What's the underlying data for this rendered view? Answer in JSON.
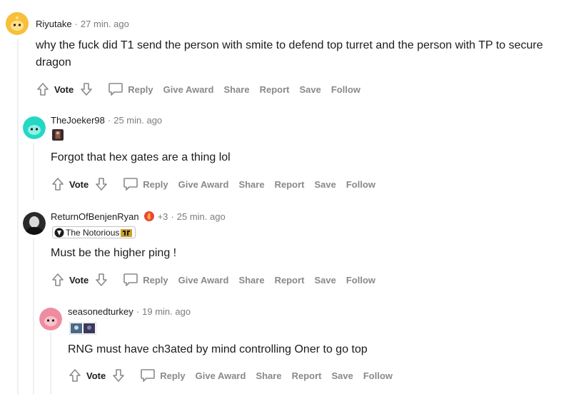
{
  "comments": [
    {
      "username": "Riyutake",
      "time": "27 min. ago",
      "body": "why the fuck did T1 send the person with smite to defend top turret and the person with TP to secure dragon",
      "avatar_color": "#f6c03c"
    },
    {
      "username": "TheJoeker98",
      "time": "25 min. ago",
      "body": "Forgot that hex gates are a thing lol",
      "avatar_color": "#24d7c4"
    },
    {
      "username": "ReturnOfBenjenRyan",
      "award_count": "+3",
      "time": "25 min. ago",
      "flair_text": "The Notorious",
      "body": "Must be the higher ping !",
      "avatar_color": "#2a2a2a"
    },
    {
      "username": "seasonedturkey",
      "time": "19 min. ago",
      "body": "RNG must have ch3ated by mind controlling Oner to go top",
      "avatar_color": "#f08ca0"
    }
  ],
  "actions": {
    "vote": "Vote",
    "reply": "Reply",
    "give_award": "Give Award",
    "share": "Share",
    "report": "Report",
    "save": "Save",
    "follow": "Follow"
  },
  "colors": {
    "meta_gray": "#7c7c7c",
    "action_gray": "#878a8c",
    "thread_line": "#edeff1"
  }
}
